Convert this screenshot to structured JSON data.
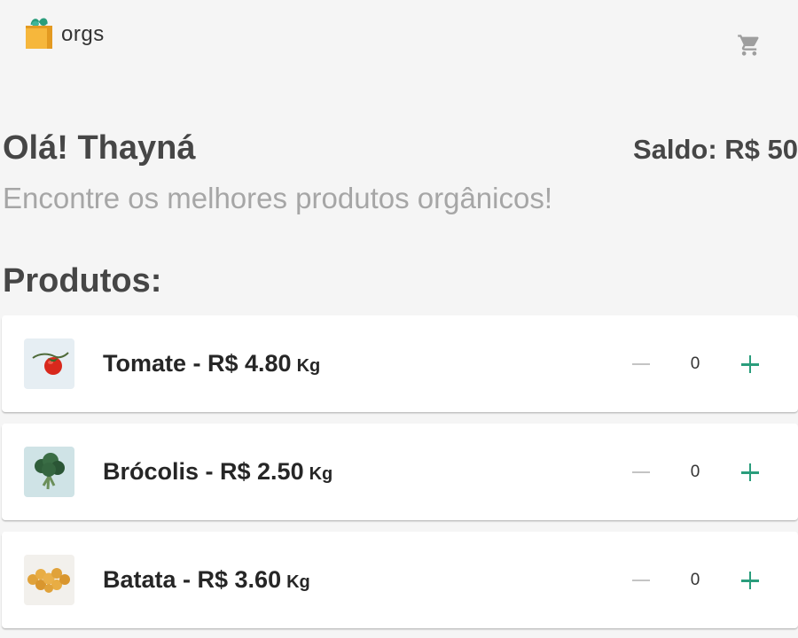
{
  "app": {
    "logo_text": "orgs"
  },
  "greeting": {
    "title": "Olá! Thayná",
    "balance": "Saldo: R$ 50",
    "subtitle": "Encontre os melhores produtos orgânicos!"
  },
  "products_section": {
    "title": "Produtos:",
    "items": [
      {
        "name": "Tomate - R$ 4.80",
        "unit": "Kg",
        "quantity": "0",
        "image": "tomato-image"
      },
      {
        "name": "Brócolis - R$ 2.50",
        "unit": "Kg",
        "quantity": "0",
        "image": "broccoli-image"
      },
      {
        "name": "Batata - R$ 3.60",
        "unit": "Kg",
        "quantity": "0",
        "image": "potato-image"
      }
    ]
  },
  "colors": {
    "background": "#f5f5f5",
    "accent": "#2a9d7c",
    "muted": "#a6a6a6",
    "heading": "#464646"
  },
  "icons": {
    "logo": "grocery-bag-icon",
    "cart": "shopping-cart-icon",
    "decrement": "minus-icon",
    "increment": "plus-icon"
  }
}
